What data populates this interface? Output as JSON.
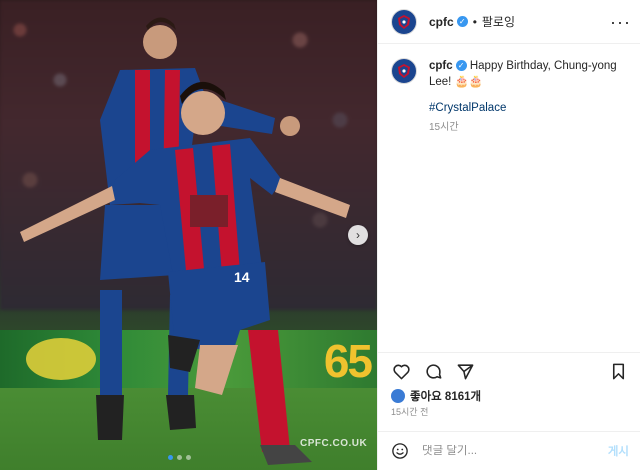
{
  "post": {
    "photo_watermark": "CPFC.CO.UK",
    "ad_board_number": "65",
    "carousel": {
      "slides": 3,
      "active_index": 0
    }
  },
  "header": {
    "username": "cpfc",
    "separator": "•",
    "follow_label": "팔로잉",
    "more_icon": "more-horizontal-icon"
  },
  "caption": {
    "username": "cpfc",
    "text": "Happy Birthday, Chung-yong Lee! 🎂🎂",
    "hashtag": "#CrystalPalace",
    "time": "15시간"
  },
  "actions": {
    "icons": [
      "heart-icon",
      "comment-icon",
      "share-icon",
      "bookmark-icon"
    ]
  },
  "likes": {
    "label": "좋아요 8161개",
    "posted_time": "15시간 전"
  },
  "comment": {
    "placeholder": "댓글 달기...",
    "post_label": "게시"
  },
  "colors": {
    "brand_blue": "#1b458f",
    "brand_red": "#c4122e",
    "verified": "#3897f0",
    "link": "#00376b"
  }
}
